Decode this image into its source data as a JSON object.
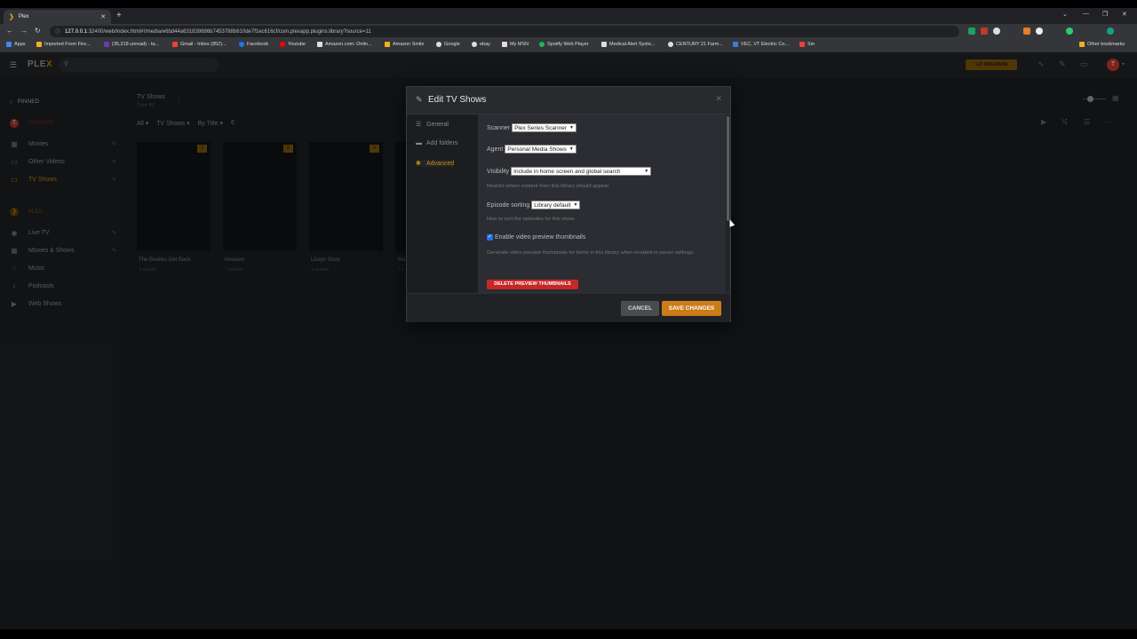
{
  "browser": {
    "tab_title": "Plex",
    "url_host": "127.0.0.1",
    "url_rest": ":32400/web/index.html#!/media/e6bd44a631839886b7453788b610de7f1ec616cf/com.plexapp.plugins.library?source=11",
    "bookmarks": [
      {
        "label": "Apps",
        "color": "#4285f4"
      },
      {
        "label": "Imported From Fire...",
        "color": "#f2b01e"
      },
      {
        "label": "(35,218 unread) - ta...",
        "color": "#6a3ab2"
      },
      {
        "label": "Gmail - Inbox (852)...",
        "color": "#ea4335"
      },
      {
        "label": "Facebook",
        "color": "#1877f2"
      },
      {
        "label": "Youtube",
        "color": "#ff0000"
      },
      {
        "label": "Amazon.com: Onlin...",
        "color": "#dddddd"
      },
      {
        "label": "Amazon Smile",
        "color": "#f2b01e"
      },
      {
        "label": "Google",
        "color": "#dddddd"
      },
      {
        "label": "ebay",
        "color": "#dddddd"
      },
      {
        "label": "My MSN",
        "color": "#dddddd"
      },
      {
        "label": "Spotify Web Player",
        "color": "#1db954"
      },
      {
        "label": "Medical Alert Syste...",
        "color": "#dddddd"
      },
      {
        "label": "CENTURY 21 Farm...",
        "color": "#dddddd"
      },
      {
        "label": "VEC, VT Electric Co...",
        "color": "#3b7bd4"
      },
      {
        "label": "Sm",
        "color": "#e84040"
      }
    ],
    "other_bookmarks": "Other bookmarks"
  },
  "plex": {
    "logo_pl": "PLE",
    "logo_x": "X",
    "premium": "GO PREMIUM",
    "avatar_letter": "T",
    "accent": "#e5a00d"
  },
  "sidebar": {
    "pinned": "PINNED",
    "server_name": "TYLER PC",
    "server_letter": "T",
    "server_items": [
      {
        "label": "Movies"
      },
      {
        "label": "Other Videos"
      },
      {
        "label": "TV Shows"
      }
    ],
    "plex_header": "PLEX",
    "plex_items": [
      {
        "label": "Live TV"
      },
      {
        "label": "Movies & Shows"
      },
      {
        "label": "Music"
      },
      {
        "label": "Podcasts"
      },
      {
        "label": "Web Shows"
      }
    ]
  },
  "library": {
    "title": "TV Shows",
    "subtitle": "Tyler PC",
    "filter_all": "All",
    "filter_type": "TV Shows",
    "filter_sort": "By Title",
    "count": "6",
    "items": [
      {
        "title": "The Beatles Get Back",
        "seasons": "1 season",
        "badge": "3"
      },
      {
        "title": "Invasion",
        "seasons": "1 season",
        "badge": "8"
      },
      {
        "title": "Liseys Story",
        "seasons": "1 season",
        "badge": "8"
      },
      {
        "title": "Ma",
        "seasons": "1 s",
        "badge": ""
      }
    ]
  },
  "modal": {
    "title": "Edit TV Shows",
    "nav": [
      {
        "label": "General"
      },
      {
        "label": "Add folders"
      },
      {
        "label": "Advanced"
      }
    ],
    "scanner_label": "Scanner",
    "scanner_value": "Plex Series Scanner",
    "agent_label": "Agent",
    "agent_value": "Personal Media Shows",
    "visibility_label": "Visibility",
    "visibility_value": "Include in home screen and global search",
    "visibility_help": "Restrict where content from this library should appear.",
    "sorting_label": "Episode sorting",
    "sorting_value": "Library default",
    "sorting_help": "How to sort the episodes for this show.",
    "thumbs_label": "Enable video preview thumbnails",
    "thumbs_help": "Generate video preview thumbnails for items in this library when enabled in server settings.",
    "delete_button": "DELETE PREVIEW THUMBNAILS",
    "cancel": "CANCEL",
    "save": "SAVE CHANGES"
  }
}
